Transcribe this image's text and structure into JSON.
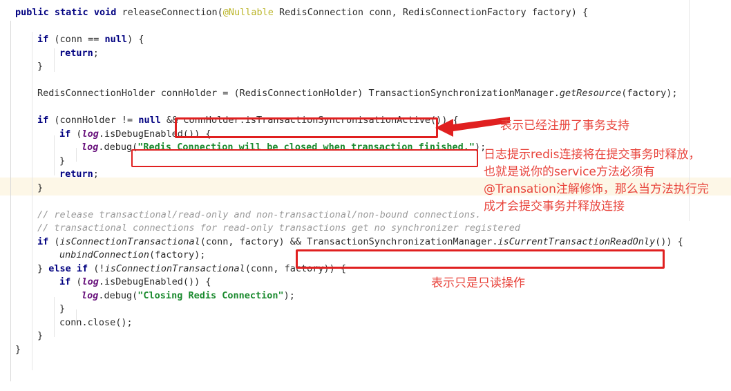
{
  "app": {
    "kind": "code-editor-screenshot",
    "language": "Java",
    "theme_background": "#ffffff",
    "caret_line_color": "#fdf6e3",
    "annotation_color": "#e8443c",
    "box_color": "#e02020"
  },
  "code": {
    "lines": [
      {
        "indent": 0,
        "tokens": [
          {
            "t": "public ",
            "c": "kw"
          },
          {
            "t": "static ",
            "c": "kw"
          },
          {
            "t": "void ",
            "c": "kw"
          },
          {
            "t": "releaseConnection",
            "c": "id"
          },
          {
            "t": "(",
            "c": "pn"
          },
          {
            "t": "@Nullable",
            "c": "ann"
          },
          {
            "t": " RedisConnection conn, RedisConnectionFactory factory) {",
            "c": "id"
          }
        ]
      },
      {
        "indent": 0,
        "tokens": []
      },
      {
        "indent": 1,
        "tokens": [
          {
            "t": "if ",
            "c": "kw"
          },
          {
            "t": "(conn == ",
            "c": "id"
          },
          {
            "t": "null",
            "c": "kw"
          },
          {
            "t": ") {",
            "c": "id"
          }
        ]
      },
      {
        "indent": 2,
        "tokens": [
          {
            "t": "return",
            "c": "kw"
          },
          {
            "t": ";",
            "c": "id"
          }
        ]
      },
      {
        "indent": 1,
        "tokens": [
          {
            "t": "}",
            "c": "id"
          }
        ]
      },
      {
        "indent": 0,
        "tokens": []
      },
      {
        "indent": 1,
        "tokens": [
          {
            "t": "RedisConnectionHolder connHolder = (RedisConnectionHolder) TransactionSynchronizationManager.",
            "c": "id"
          },
          {
            "t": "getResource",
            "c": "fn"
          },
          {
            "t": "(factory);",
            "c": "id"
          }
        ]
      },
      {
        "indent": 0,
        "tokens": []
      },
      {
        "indent": 1,
        "tokens": [
          {
            "t": "if ",
            "c": "kw"
          },
          {
            "t": "(connHolder != ",
            "c": "id"
          },
          {
            "t": "null",
            "c": "kw"
          },
          {
            "t": " && connHolder.isTransactionSyncronisationActive()) {",
            "c": "id"
          }
        ]
      },
      {
        "indent": 2,
        "tokens": [
          {
            "t": "if ",
            "c": "kw"
          },
          {
            "t": "(",
            "c": "id"
          },
          {
            "t": "log",
            "c": "var"
          },
          {
            "t": ".isDebugEnabled()) {",
            "c": "id"
          }
        ]
      },
      {
        "indent": 3,
        "tokens": [
          {
            "t": "log",
            "c": "var"
          },
          {
            "t": ".debug(",
            "c": "id"
          },
          {
            "t": "\"Redis Connection will be closed when transaction finished.\"",
            "c": "str"
          },
          {
            "t": ");",
            "c": "id"
          }
        ]
      },
      {
        "indent": 2,
        "tokens": [
          {
            "t": "}",
            "c": "id"
          }
        ]
      },
      {
        "indent": 2,
        "tokens": [
          {
            "t": "return",
            "c": "kw"
          },
          {
            "t": ";",
            "c": "id"
          }
        ]
      },
      {
        "indent": 1,
        "tokens": [
          {
            "t": "}",
            "c": "id"
          }
        ]
      },
      {
        "indent": 0,
        "tokens": []
      },
      {
        "indent": 1,
        "tokens": [
          {
            "t": "// release transactional/read-only and non-transactional/non-bound connections.",
            "c": "cmt"
          }
        ]
      },
      {
        "indent": 1,
        "tokens": [
          {
            "t": "// transactional connections for read-only transactions get no synchronizer registered",
            "c": "cmt"
          }
        ]
      },
      {
        "indent": 1,
        "tokens": [
          {
            "t": "if ",
            "c": "kw"
          },
          {
            "t": "(",
            "c": "id"
          },
          {
            "t": "isConnectionTransactional",
            "c": "fn"
          },
          {
            "t": "(conn, factory) && TransactionSynchronizationManager.",
            "c": "id"
          },
          {
            "t": "isCurrentTransactionReadOnly",
            "c": "fn"
          },
          {
            "t": "()) {",
            "c": "id"
          }
        ]
      },
      {
        "indent": 2,
        "tokens": [
          {
            "t": "unbindConnection",
            "c": "fn"
          },
          {
            "t": "(factory);",
            "c": "id"
          }
        ]
      },
      {
        "indent": 1,
        "tokens": [
          {
            "t": "} ",
            "c": "id"
          },
          {
            "t": "else if ",
            "c": "kw"
          },
          {
            "t": "(!",
            "c": "id"
          },
          {
            "t": "isConnectionTransactional",
            "c": "fn"
          },
          {
            "t": "(conn, factory)) {",
            "c": "id"
          }
        ]
      },
      {
        "indent": 2,
        "tokens": [
          {
            "t": "if ",
            "c": "kw"
          },
          {
            "t": "(",
            "c": "id"
          },
          {
            "t": "log",
            "c": "var"
          },
          {
            "t": ".isDebugEnabled()) {",
            "c": "id"
          }
        ]
      },
      {
        "indent": 3,
        "tokens": [
          {
            "t": "log",
            "c": "var"
          },
          {
            "t": ".debug(",
            "c": "id"
          },
          {
            "t": "\"Closing Redis Connection\"",
            "c": "str"
          },
          {
            "t": ");",
            "c": "id"
          }
        ]
      },
      {
        "indent": 2,
        "tokens": [
          {
            "t": "}",
            "c": "id"
          }
        ]
      },
      {
        "indent": 2,
        "tokens": [
          {
            "t": "conn.close();",
            "c": "id"
          }
        ]
      },
      {
        "indent": 1,
        "tokens": [
          {
            "t": "}",
            "c": "id"
          }
        ]
      },
      {
        "indent": 0,
        "tokens": [
          {
            "t": "}",
            "c": "id"
          }
        ]
      }
    ]
  },
  "annotations": {
    "note_1": "表示已经注册了事务支持",
    "note_2": "日志提示redis连接将在提交事务时释放，也就是说你的service方法必须有@Transation注解修饰，那么当方法执行完成才会提交事务并释放连接",
    "note_3": "表示只是只读操作",
    "boxes": [
      {
        "name": "transaction-sync-active-box",
        "label": "connHolder.isTransactionSyncronisationActive()"
      },
      {
        "name": "debug-log-message-box",
        "label": "\"Redis Connection will be closed when transaction finished.\");"
      },
      {
        "name": "read-only-check-box",
        "label": "TransactionSynchronizationManager.isCurrentTransactionReadOnly())"
      }
    ],
    "arrow": {
      "name": "pointer-arrow",
      "direction": "left"
    }
  }
}
